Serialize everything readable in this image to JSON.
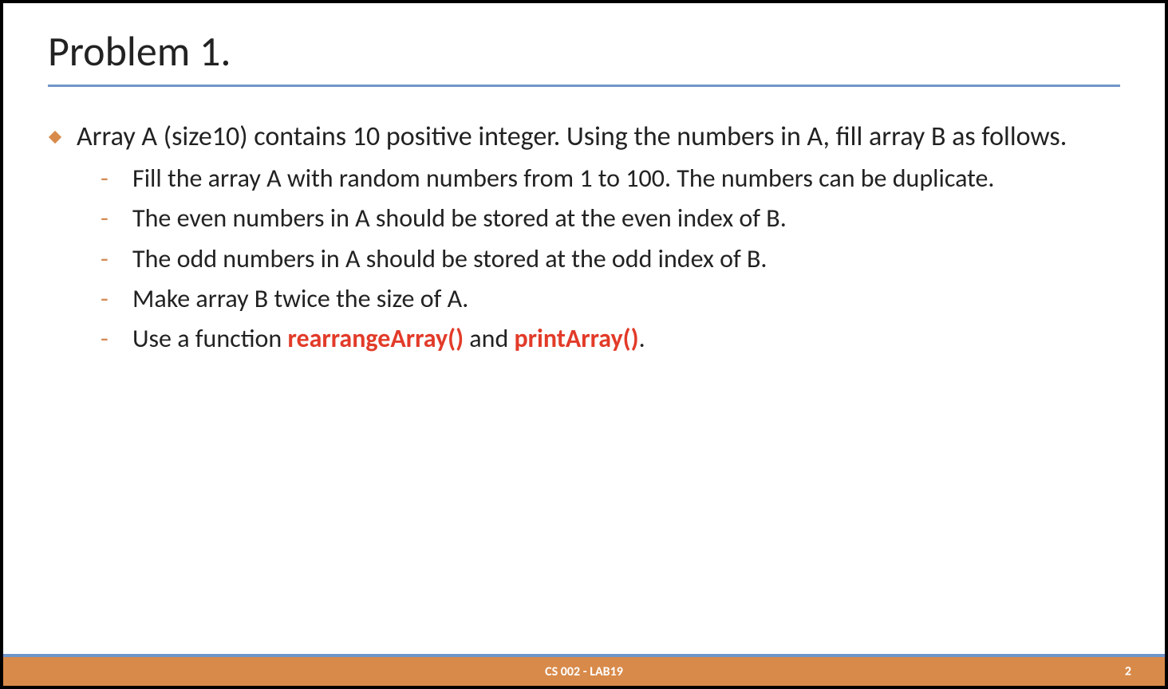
{
  "title": "Problem 1.",
  "main_bullet": "Array A (size10) contains 10 positive integer. Using the numbers in A, fill array B as follows.",
  "sub_bullets": [
    "Fill the array A with random numbers from 1 to 100. The numbers can be duplicate.",
    "The even numbers in A should be stored at the even index of B.",
    "The odd numbers in A should be stored at the odd index of B.",
    "Make array B twice the size of A."
  ],
  "last_bullet": {
    "pre": "Use a function ",
    "fn1": "rearrangeArray()",
    "mid": " and ",
    "fn2": "printArray()",
    "post": "."
  },
  "footer": {
    "label": "CS 002 - LAB19",
    "page": "2"
  },
  "colors": {
    "accent_blue": "#6f96c9",
    "accent_orange": "#d88a4a",
    "highlight_red": "#e23b29"
  }
}
